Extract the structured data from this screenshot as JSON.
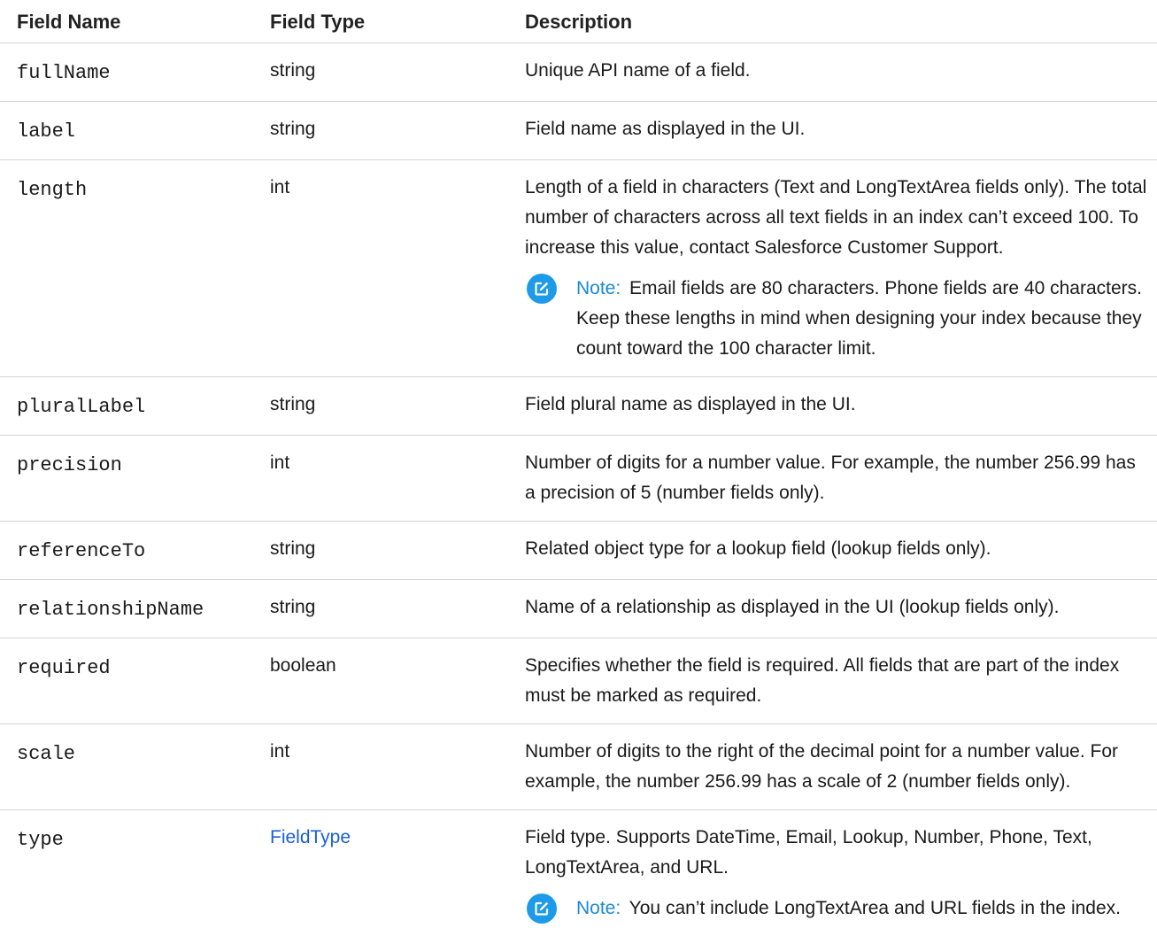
{
  "table": {
    "headers": [
      "Field Name",
      "Field Type",
      "Description"
    ],
    "rows": [
      {
        "name": "fullName",
        "type": "string",
        "desc": "Unique API name of a field."
      },
      {
        "name": "label",
        "type": "string",
        "desc": "Field name as displayed in the UI."
      },
      {
        "name": "length",
        "type": "int",
        "desc": "Length of a field in characters (Text and LongTextArea fields only). The total number of characters across all text fields in an index can’t exceed 100. To increase this value, contact Salesforce Customer Support.",
        "note": "Email fields are 80 characters. Phone fields are 40 characters. Keep these lengths in mind when designing your index because they count toward the 100 character limit."
      },
      {
        "name": "pluralLabel",
        "type": "string",
        "desc": "Field plural name as displayed in the UI."
      },
      {
        "name": "precision",
        "type": "int",
        "desc": "Number of digits for a number value. For example, the number 256.99 has a precision of 5 (number fields only)."
      },
      {
        "name": "referenceTo",
        "type": "string",
        "desc": "Related object type for a lookup field (lookup fields only)."
      },
      {
        "name": "relationshipName",
        "type": "string",
        "desc": "Name of a relationship as displayed in the UI (lookup fields only)."
      },
      {
        "name": "required",
        "type": "boolean",
        "desc": "Specifies whether the field is required. All fields that are part of the index must be marked as required."
      },
      {
        "name": "scale",
        "type": "int",
        "desc": "Number of digits to the right of the decimal point for a number value. For example, the number 256.99 has a scale of 2 (number fields only)."
      },
      {
        "name": "type",
        "type": "FieldType",
        "desc": "Field type. Supports DateTime, Email, Lookup, Number, Phone, Text, LongTextArea, and URL.",
        "note": "You can’t include LongTextArea and URL fields in the index."
      }
    ]
  },
  "note_label": "Note:",
  "icons": {
    "note": "note-edit-icon"
  },
  "colors": {
    "link": "#1a5fd6",
    "note_icon": "#1d9be8",
    "note_label": "#1a89d6"
  }
}
